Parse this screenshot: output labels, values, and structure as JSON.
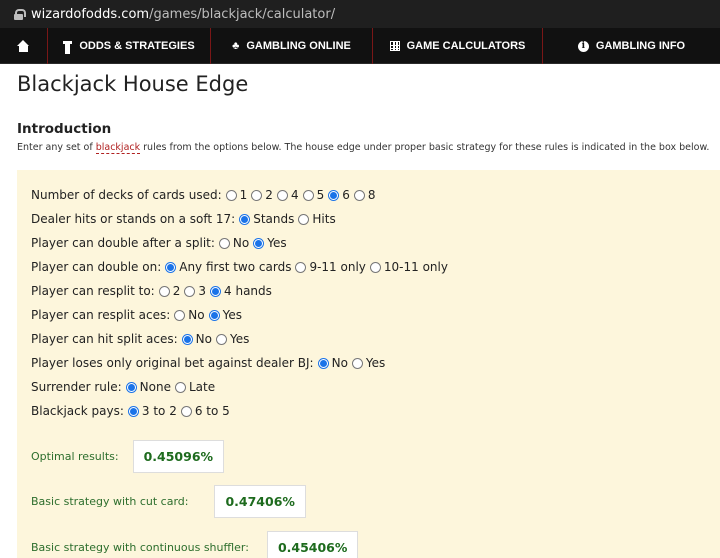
{
  "browser": {
    "url_host": "wizardofodds.com",
    "url_path": "/games/blackjack/calculator/"
  },
  "nav": {
    "items": [
      {
        "label": "ODDS & STRATEGIES",
        "icon": "rook-icon"
      },
      {
        "label": "GAMBLING ONLINE",
        "icon": "club-icon"
      },
      {
        "label": "GAME CALCULATORS",
        "icon": "grid-icon"
      },
      {
        "label": "GAMBLING INFO",
        "icon": "info-icon"
      }
    ],
    "home_icon": "home-icon"
  },
  "page": {
    "title": "Blackjack House Edge",
    "section_title": "Introduction",
    "intro_pre": "Enter any set of ",
    "intro_link": "blackjack",
    "intro_post": " rules from the options below. The house edge under proper basic strategy for these rules is indicated in the box below."
  },
  "rules": [
    {
      "label": "Number of decks of cards used:",
      "options": [
        "1",
        "2",
        "4",
        "5",
        "6",
        "8"
      ],
      "selected": 4
    },
    {
      "label": "Dealer hits or stands on a soft 17:",
      "options": [
        "Stands",
        "Hits"
      ],
      "selected": 0
    },
    {
      "label": "Player can double after a split:",
      "options": [
        "No",
        "Yes"
      ],
      "selected": 1
    },
    {
      "label": "Player can double on:",
      "options": [
        "Any first two cards",
        "9-11 only",
        "10-11 only"
      ],
      "selected": 0
    },
    {
      "label": "Player can resplit to:",
      "options": [
        "2",
        "3",
        "4 hands"
      ],
      "selected": 2
    },
    {
      "label": "Player can resplit aces:",
      "options": [
        "No",
        "Yes"
      ],
      "selected": 1
    },
    {
      "label": "Player can hit split aces:",
      "options": [
        "No",
        "Yes"
      ],
      "selected": 0
    },
    {
      "label": "Player loses only original bet against dealer BJ:",
      "options": [
        "No",
        "Yes"
      ],
      "selected": 0
    },
    {
      "label": "Surrender rule:",
      "options": [
        "None",
        "Late"
      ],
      "selected": 0
    },
    {
      "label": "Blackjack pays:",
      "options": [
        "3 to 2",
        "6 to 5"
      ],
      "selected": 0
    }
  ],
  "results": [
    {
      "label": "Optimal results:",
      "value": "0.45096%"
    },
    {
      "label": "Basic strategy with cut card:",
      "value": "0.47406%"
    },
    {
      "label": "Basic strategy with continuous shuffler:",
      "value": "0.45406%"
    }
  ],
  "colors": {
    "panel_bg": "#fdf6dc",
    "radio_checked": "#1a73e8",
    "result_text": "#1e6b1e",
    "nav_bg": "#111111",
    "nav_divider": "#7a1717"
  }
}
